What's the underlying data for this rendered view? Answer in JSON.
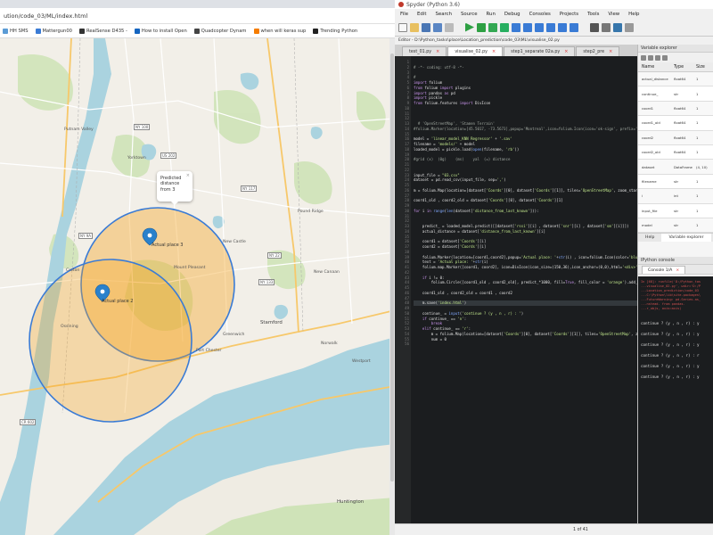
{
  "browser": {
    "url": "ution/code_03/ML/index.html",
    "bookmarks": [
      {
        "label": "HH SMS",
        "color": "#5b9bd5"
      },
      {
        "label": "Mattergun00",
        "color": "#3a7bd5"
      },
      {
        "label": "RealSense D435 -",
        "color": "#333333"
      },
      {
        "label": "How to install Open",
        "color": "#1565c0"
      },
      {
        "label": "Quadcopter Dynam",
        "color": "#444444"
      },
      {
        "label": "when will keras sup",
        "color": "#f57c00"
      },
      {
        "label": "Trending Python",
        "color": "#222222"
      }
    ],
    "map": {
      "popup": {
        "line1": "Predicted",
        "line2": "distance",
        "line3": "from 3",
        "close": "×"
      },
      "marker_labels": [
        "Actual place 3",
        "Actual place 2"
      ],
      "places": [
        "Putnam Valley",
        "Yorktown",
        "Ossining",
        "Croton",
        "New Castle",
        "Mount Pleasant",
        "Pound Ridge",
        "New Canaan",
        "Stamford",
        "Norwalk",
        "Westport",
        "Huntington",
        "Greenwich",
        "Port Chester"
      ],
      "route_shields": [
        "US 202",
        "NY 132",
        "NY 22",
        "NY 100",
        "NY 9A",
        "CR 602",
        "NY 133",
        "NY 117"
      ],
      "colors": {
        "water": "#aad3df",
        "land": "#f2efe8",
        "green": "#c8e0b0",
        "circle": "#3a7bd5",
        "fill": "#f5a623"
      }
    }
  },
  "spyder": {
    "title": "Spyder (Python 3.6)",
    "menu": [
      "File",
      "Edit",
      "Search",
      "Source",
      "Run",
      "Debug",
      "Consoles",
      "Projects",
      "Tools",
      "View",
      "Help"
    ],
    "path": "Editor - D:\\Python_tasks\\place\\Location_prediction\\code_03\\ML\\visualise_02.py",
    "tabs": [
      {
        "label": "test_01.py",
        "active": false
      },
      {
        "label": "visualise_02.py",
        "active": true
      },
      {
        "label": "step1_separate 02a.py",
        "active": false
      },
      {
        "label": "step2_pre",
        "active": false
      }
    ],
    "code": [
      "",
      "# -*- coding: utf-8 -*-",
      "",
      "# ",
      "import folium",
      "from folium import plugins",
      "import pandas as pd",
      "import pickle",
      "from folium.features import DivIcon",
      "",
      "",
      "",
      "  # 'OpenStreetMap', 'Stamen Terrain'",
      "#folium.Marker(location=[45.5017, -73.5673],popup='Montreal',icon=folium.Icon(icon='ok-sign', prefix='glyphicon')).add_to(m)",
      "",
      "model = 'linear_model_KNN Regressor' + '.sav'",
      "filename = 'models/' + model",
      "loaded_model = pickle.load(open(filename, 'rb'))",
      "",
      "#grid (x)  (0g)    (ms)    yal  (=) distance",
      "",
      "",
      "input_file = \"03.csv\"",
      "dataset = pd.read_csv(input_file, sep=',')",
      "",
      "m = folium.Map(location=[dataset['Coords'][0], dataset['Coords'][1]], tiles='OpenStreetMap', zoom_start=11)",
      "",
      "coord1_old , coord2_old = dataset['Coords'][0], dataset['Coords'][1]",
      "",
      "for i in range(len(dataset['distance_from_last_known'])):",
      "",
      "",
      "    predict_ = loaded_model.predict([[dataset['rssi'][i] , dataset['snr'][i] , dataset['sm'][i]]])",
      "    actual_distance = dataset['distance_from_last_known'][i]",
      "",
      "    coord1 = dataset['Coords'][i]",
      "    coord2 = dataset['Coords'][i]",
      "",
      "    folium.Marker(location=[coord1,coord2],popup='Actual place: '+str(i) , icon=folium.Icon(color='blue')).add_to(m)",
      "    text = 'Actual place: '+str(i)",
      "    folium.map.Marker([coord1, coord2], icon=DivIcon(icon_size=(150,36),icon_anchor=(0,0),html='<div>'+text+'</div>')).add_to(m)",
      "",
      "    if i != 0:",
      "        folium.Circle([coord1_old , coord2_old], predict_*1000, fill=True, fill_color = 'orange').add_to(m)",
      "",
      "    coord1_old , coord2_old = coord1 , coord2",
      "",
      "    m.save('index.html')",
      "",
      "    continue_ = input('continue ? (y , n , r) : ')",
      "    if continue_ == 'n':",
      "        break",
      "    elif continue_ == 'r':",
      "        m = folium.Map(location=[dataset['Coords'][0], dataset['Coords'][1]], tiles='OpenStreetMap', zoom_start=11)",
      "        num = 0",
      ""
    ],
    "varexplorer": {
      "title": "Variable explorer",
      "headers": [
        "Name",
        "Type",
        "Size"
      ],
      "rows": [
        {
          "name": "actual_distance",
          "type": "float64",
          "size": "1"
        },
        {
          "name": "continue_",
          "type": "str",
          "size": "1"
        },
        {
          "name": "coord1",
          "type": "float64",
          "size": "1"
        },
        {
          "name": "coord1_old",
          "type": "float64",
          "size": "1"
        },
        {
          "name": "coord2",
          "type": "float64",
          "size": "1"
        },
        {
          "name": "coord2_old",
          "type": "float64",
          "size": "1"
        },
        {
          "name": "dataset",
          "type": "DataFrame",
          "size": "(4, 10)"
        },
        {
          "name": "filename",
          "type": "str",
          "size": "1"
        },
        {
          "name": "i",
          "type": "int",
          "size": "1"
        },
        {
          "name": "input_file",
          "type": "str",
          "size": "1"
        },
        {
          "name": "model",
          "type": "str",
          "size": "1"
        }
      ],
      "tabs": [
        "Help",
        "Variable explorer"
      ]
    },
    "console": {
      "title": "IPython console",
      "tab": "Console 1/A",
      "err_lines": [
        "In [68]: runfile('D:/Python_tas",
        "...visualise_02.py', wdir='D:/P",
        "...Location_prediction/code_03",
        "...C:\\Python\\lib\\site-packages\\",
        "...FutureWarning: pd.Series.as_",
        "...nstead. from pandas.",
        "...r_objs, axis=axis)"
      ],
      "prompts": [
        "continue ? (y , n , r) : y",
        "continue ? (y , n , r) : y",
        "continue ? (y , n , r) : y",
        "continue ? (y , n , r) : r",
        "continue ? (y , n , r) : y",
        "continue ? (y , n , r) : y"
      ]
    },
    "status": "1 of 41"
  }
}
